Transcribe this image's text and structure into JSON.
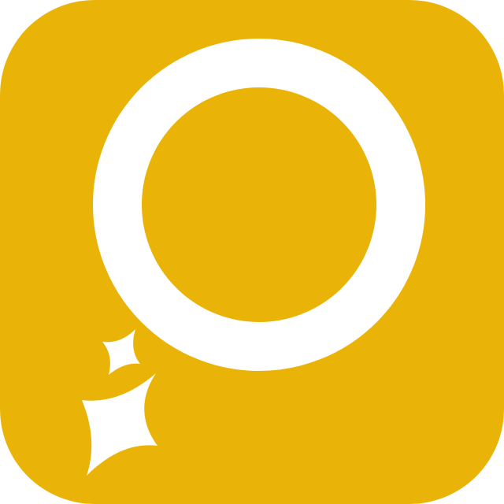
{
  "icon": {
    "name": "search-sparkle-app-icon",
    "background_color": "#EAB308",
    "foreground_color": "#FFFFFF",
    "glyph": "magnifier-ring-with-sparkles"
  }
}
